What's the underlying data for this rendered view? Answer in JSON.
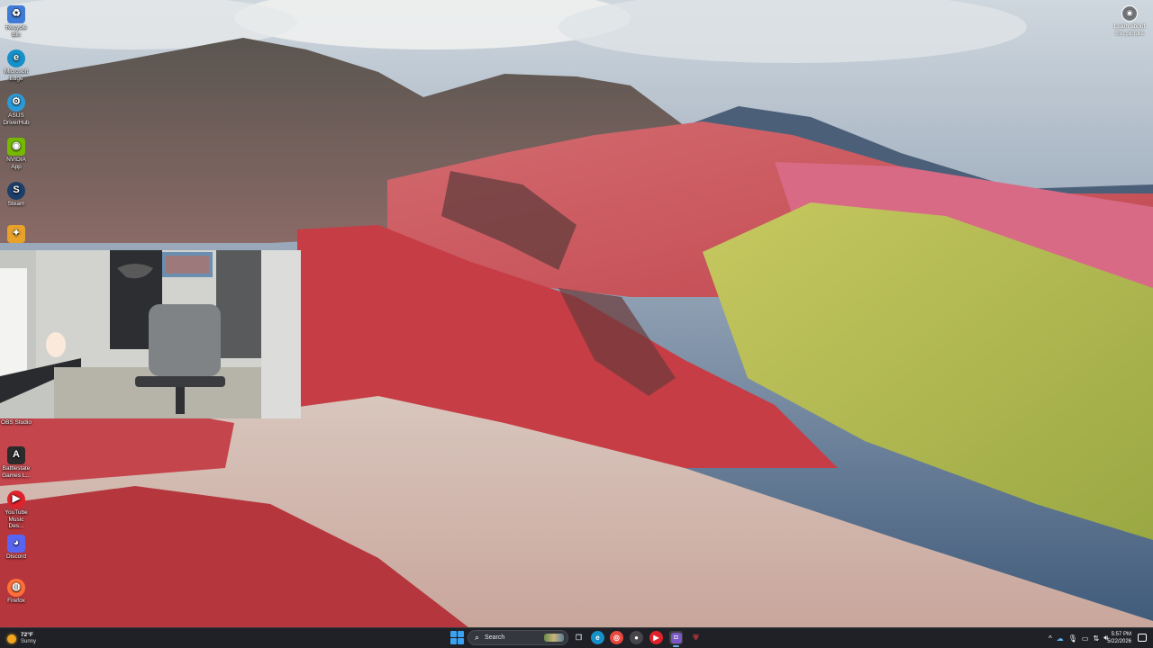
{
  "desktop": {
    "icons": [
      {
        "label": "Recycle Bin",
        "icon": "recycle-bin-icon",
        "color": "#3f7bd6",
        "glyph": "♻"
      },
      {
        "label": "Microsoft Edge",
        "icon": "edge-icon",
        "color": "#1690c9",
        "glyph": "e"
      },
      {
        "label": "ASUS DriverHub",
        "icon": "asus-driverhub-icon",
        "color": "#2b9bd8",
        "glyph": "⚙"
      },
      {
        "label": "NVIDIA App",
        "icon": "nvidia-icon",
        "color": "#76b900",
        "glyph": "◉"
      },
      {
        "label": "Steam",
        "icon": "steam-icon",
        "color": "#1b3f6a",
        "glyph": "S"
      },
      {
        "label": "OBS Studio",
        "icon": "obs-icon",
        "color": "#302e31",
        "glyph": "●"
      },
      {
        "label": "Battlestate Games L...",
        "icon": "battlestate-icon",
        "color": "#2b2b2b",
        "glyph": "A"
      },
      {
        "label": "YouTube Music Des...",
        "icon": "youtube-music-icon",
        "color": "#e0222c",
        "glyph": "▶"
      },
      {
        "label": "Discord",
        "icon": "discord-icon",
        "color": "#5865f2",
        "glyph": "◕"
      },
      {
        "label": "Firefox",
        "icon": "firefox-icon",
        "color": "#ff7139",
        "glyph": "◍"
      }
    ],
    "learn_picture": "Learn about this picture"
  },
  "taskbar": {
    "weather": {
      "temp": "72°F",
      "condition": "Sunny"
    },
    "search_placeholder": "Search",
    "apps": [
      {
        "name": "task-view-icon",
        "color": "#3a3d44",
        "glyph": "❐",
        "active": false
      },
      {
        "name": "edge-taskbar-icon",
        "color": "#1690c9",
        "glyph": "e",
        "active": false
      },
      {
        "name": "chrome-icon",
        "color": "#e9483f",
        "glyph": "◎",
        "active": false
      },
      {
        "name": "obs-taskbar-icon",
        "color": "#48464a",
        "glyph": "●",
        "active": false
      },
      {
        "name": "youtube-music-taskbar-icon",
        "color": "#e0222c",
        "glyph": "▶",
        "active": false
      },
      {
        "name": "recording-app-icon",
        "color": "#7a59c4",
        "glyph": "◘",
        "active": true
      },
      {
        "name": "shield-app-icon",
        "color": "#9b1b1b",
        "glyph": "⛨",
        "active": false
      }
    ],
    "tray": {
      "chevron": "^",
      "icons": [
        "network-icon",
        "mic-icon",
        "display-icon",
        "volume-icon"
      ]
    },
    "clock": {
      "time": "5:57 PM",
      "date": "5/22/2026"
    }
  }
}
